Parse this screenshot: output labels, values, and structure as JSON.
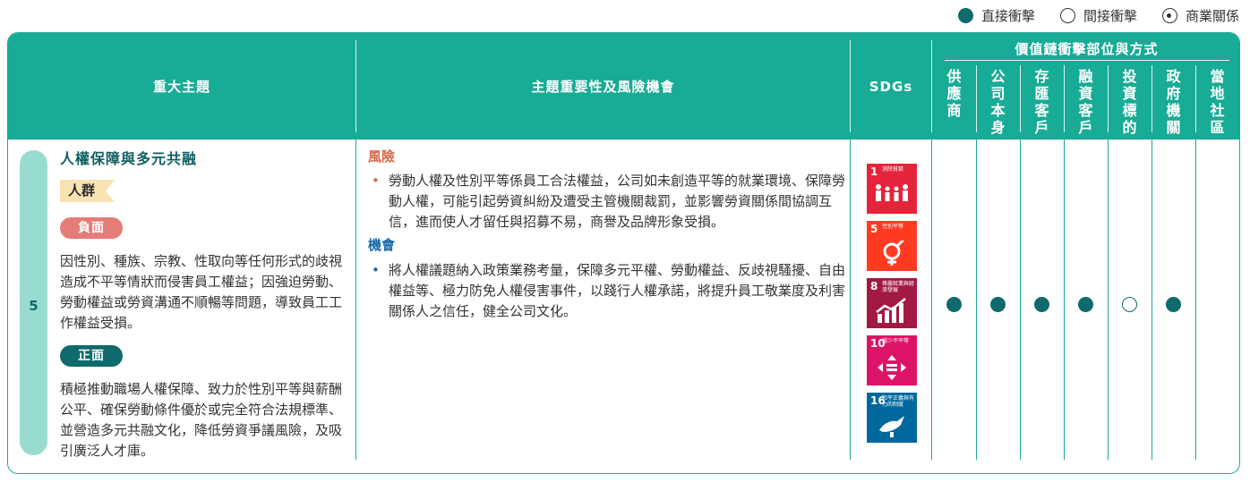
{
  "legend": {
    "direct": "直接衝擊",
    "indirect": "間接衝擊",
    "business": "商業關係"
  },
  "header": {
    "topic": "重大主題",
    "importance": "主題重要性及風險機會",
    "sdgs": "SDGs",
    "value_chain": "價值鏈衝擊部位與方式",
    "stakeholders": [
      "供應商",
      "公司本身",
      "存匯客戶",
      "融資客戶",
      "投資標的",
      "政府機關",
      "當地社區"
    ]
  },
  "row": {
    "number": "5",
    "title": "人權保障與多元共融",
    "group_tag": "人群",
    "negative_label": "負面",
    "negative_text": "因性別、種族、宗教、性取向等任何形式的歧視造成不平等情狀而侵害員工權益；因強迫勞動、勞動權益或勞資溝通不順暢等問題，導致員工工作權益受損。",
    "positive_label": "正面",
    "positive_text": "積極推動職場人權保障、致力於性別平等與薪酬公平、確保勞動條件優於或完全符合法規標準、並營造多元共融文化，降低勞資爭議風險，及吸引廣泛人才庫。",
    "risk_title": "風險",
    "risk_text": "勞動人權及性別平等係員工合法權益，公司如未創造平等的就業環境、保障勞動人權，可能引起勞資糾紛及遭受主管機關裁罰，並影響勞資關係間協調互信，進而使人才留任與招募不易，商譽及品牌形象受損。",
    "opportunity_title": "機會",
    "opportunity_text": "將人權議題納入政策業務考量，保障多元平權、勞動權益、反歧視騷擾、自由權益等、極力防免人權侵害事件，以踐行人權承諾，將提升員工敬業度及利害關係人之信任，健全公司文化。",
    "sdgs": [
      {
        "num": "1",
        "label": "消除貧窮",
        "color": "#e5243b",
        "icon": "people-icon"
      },
      {
        "num": "5",
        "label": "性別平等",
        "color": "#ff3a21",
        "icon": "gender-icon"
      },
      {
        "num": "8",
        "label": "尊嚴就業與經濟發展",
        "color": "#a21942",
        "icon": "growth-chart-icon"
      },
      {
        "num": "10",
        "label": "減少不平等",
        "color": "#dd1367",
        "icon": "equality-icon"
      },
      {
        "num": "16",
        "label": "和平正義與有力的制度",
        "color": "#00689d",
        "icon": "dove-icon"
      }
    ],
    "impacts": [
      "direct",
      "direct",
      "direct",
      "direct",
      "indirect",
      "direct",
      "none"
    ]
  }
}
